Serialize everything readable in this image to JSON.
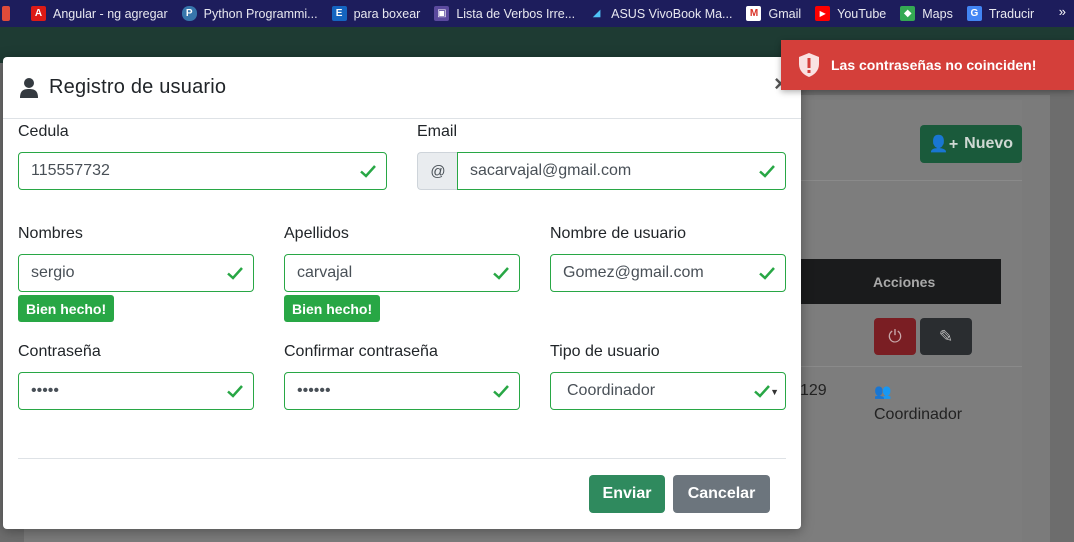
{
  "bookmarks": [
    {
      "label": "",
      "icon": "apps-icon",
      "color": "#e04b3a"
    },
    {
      "label": "Angular - ng agregar",
      "icon": "angular-icon",
      "color": "#dd1b16"
    },
    {
      "label": "Python Programmi...",
      "icon": "python-icon",
      "color": "#3776ab"
    },
    {
      "label": "para boxear",
      "icon": "e-icon",
      "color": "#1565c0"
    },
    {
      "label": "Lista de Verbos Irre...",
      "icon": "book-icon",
      "color": "#5b4a9e"
    },
    {
      "label": "ASUS VivoBook Ma...",
      "icon": "asus-icon",
      "color": "#1e88e5"
    },
    {
      "label": "Gmail",
      "icon": "gmail-icon",
      "color": "#d93025"
    },
    {
      "label": "YouTube",
      "icon": "youtube-icon",
      "color": "#ff0000"
    },
    {
      "label": "Maps",
      "icon": "maps-icon",
      "color": "#34a853"
    },
    {
      "label": "Traducir",
      "icon": "translate-icon",
      "color": "#4285f4"
    }
  ],
  "bookmarks_more": "»",
  "background": {
    "new_button": "Nuevo",
    "table_header": "Acciones",
    "row_partial_id": "129",
    "row_role": "Coordinador"
  },
  "modal": {
    "title": "Registro de usuario",
    "close": "×",
    "fields": {
      "cedula": {
        "label": "Cedula",
        "value": "115557732"
      },
      "email": {
        "label": "Email",
        "addon": "@",
        "value": "sacarvajal@gmail.com"
      },
      "nombres": {
        "label": "Nombres",
        "value": "sergio",
        "feedback": "Bien hecho!"
      },
      "apellidos": {
        "label": "Apellidos",
        "value": "carvajal",
        "feedback": "Bien hecho!"
      },
      "usuario": {
        "label": "Nombre de usuario",
        "value": "Gomez@gmail.com"
      },
      "contrasena": {
        "label": "Contraseña",
        "value": "•••••"
      },
      "confirmar": {
        "label": "Confirmar contraseña",
        "value": "••••••"
      },
      "tipo": {
        "label": "Tipo de usuario",
        "value": "Coordinador"
      }
    },
    "buttons": {
      "send": "Enviar",
      "cancel": "Cancelar"
    }
  },
  "toast": {
    "message": "Las contraseñas no coinciden!"
  },
  "colors": {
    "valid": "#28a745",
    "toast": "#d43f3a",
    "primary": "#2f8a5e"
  }
}
